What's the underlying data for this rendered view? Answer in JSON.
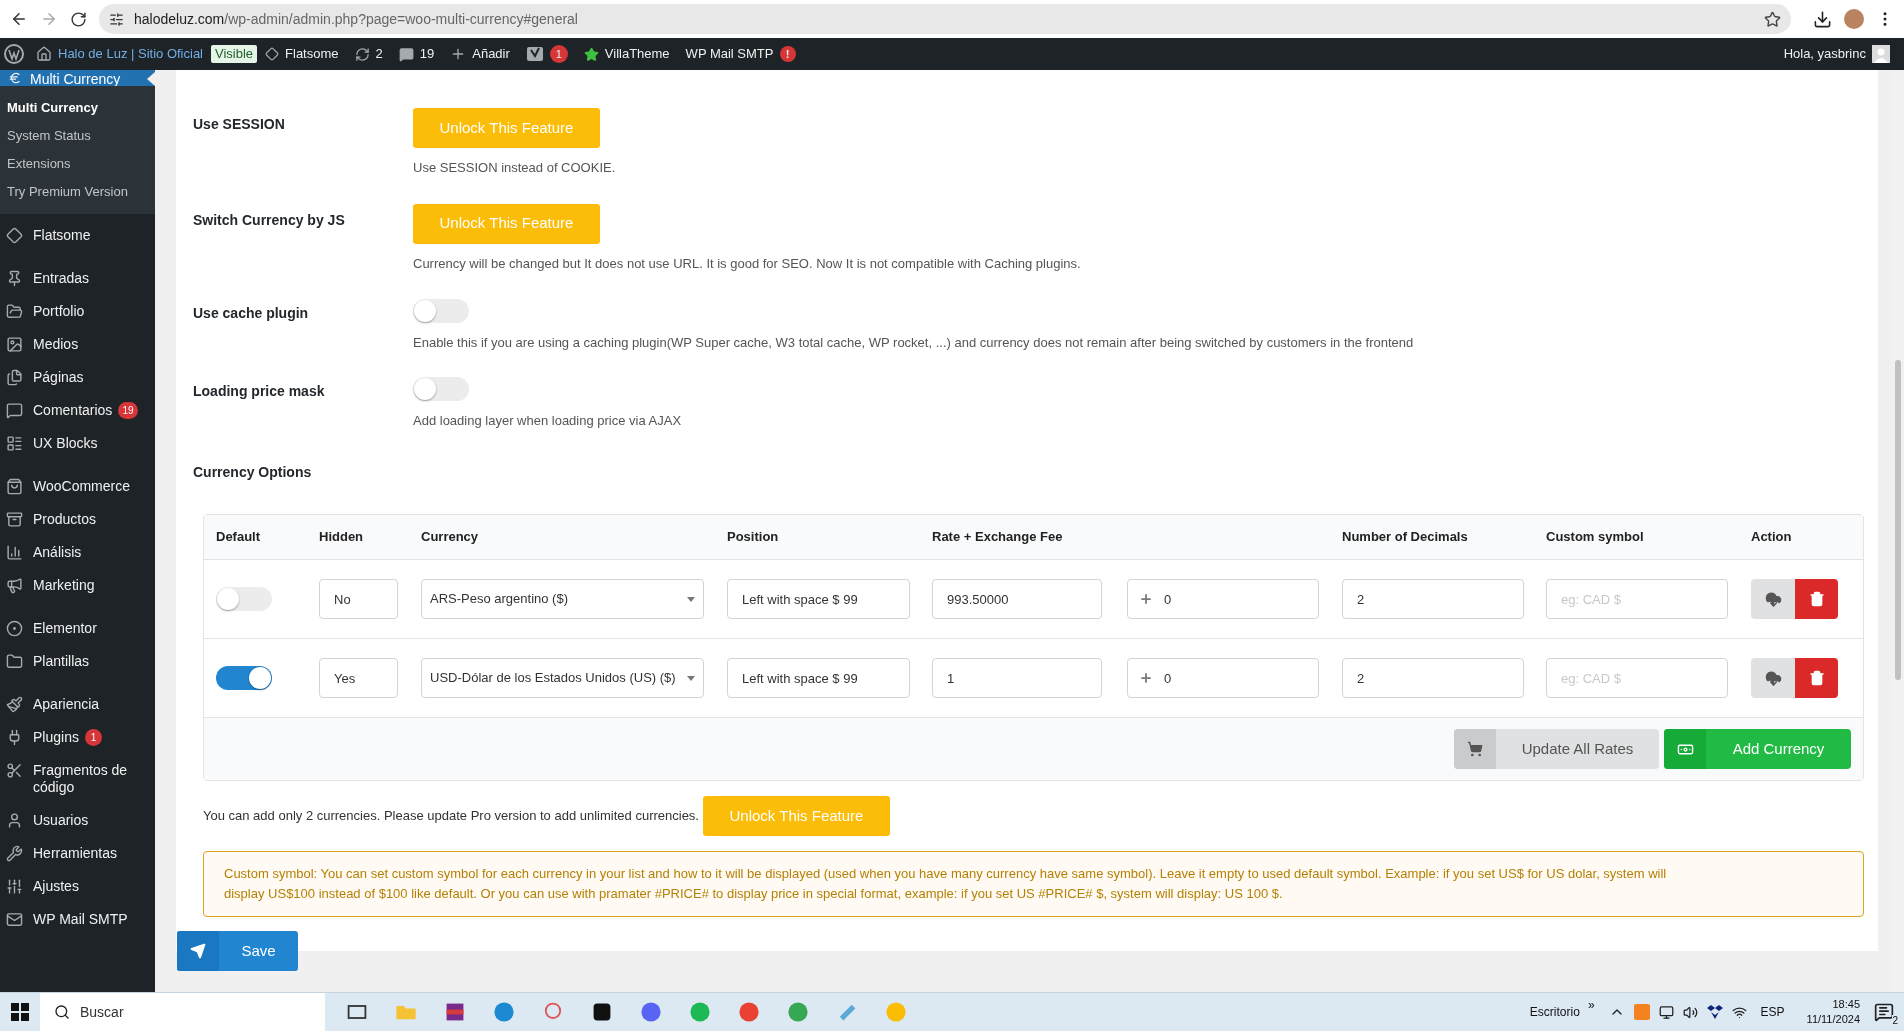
{
  "browser": {
    "url_host": "halodeluz.com",
    "url_path": "/wp-admin/admin.php?page=woo-multi-currency#general"
  },
  "admin_bar": {
    "site": "Halo de Luz | Sitio Oficial",
    "visibility": "Visible",
    "theme": "Flatsome",
    "updates": "2",
    "comments": "19",
    "new": "Añadir",
    "seo_count": "1",
    "villatheme": "VillaTheme",
    "smtp": "WP Mail SMTP",
    "smtp_alert": "!",
    "greeting": "Hola, yasbrinc"
  },
  "sidebar": {
    "current": "Multi Currency",
    "submenu": [
      {
        "label": "Multi Currency",
        "selected": true
      },
      {
        "label": "System Status",
        "selected": false
      },
      {
        "label": "Extensions",
        "selected": false
      },
      {
        "label": "Try Premium Version",
        "selected": false
      }
    ],
    "groups": [
      [
        {
          "label": "Flatsome"
        }
      ],
      [
        {
          "label": "Entradas"
        },
        {
          "label": "Portfolio"
        },
        {
          "label": "Medios"
        },
        {
          "label": "Páginas"
        },
        {
          "label": "Comentarios",
          "badge": "19"
        },
        {
          "label": "UX Blocks"
        }
      ],
      [
        {
          "label": "WooCommerce"
        },
        {
          "label": "Productos"
        },
        {
          "label": "Análisis"
        },
        {
          "label": "Marketing"
        }
      ],
      [
        {
          "label": "Elementor"
        },
        {
          "label": "Plantillas"
        }
      ],
      [
        {
          "label": "Apariencia"
        },
        {
          "label": "Plugins",
          "badge": "1"
        },
        {
          "label": "Fragmentos de código"
        },
        {
          "label": "Usuarios"
        },
        {
          "label": "Herramientas"
        },
        {
          "label": "Ajustes"
        },
        {
          "label": "WP Mail SMTP"
        }
      ]
    ]
  },
  "settings": [
    {
      "kind": "locked",
      "label": "Use SESSION",
      "button": "Unlock This Feature",
      "description": "Use SESSION instead of COOKIE."
    },
    {
      "kind": "locked",
      "label": "Switch Currency by JS",
      "button": "Unlock This Feature",
      "description": "Currency will be changed but It does not use URL. It is good for SEO. Now It is not compatible with Caching plugins."
    },
    {
      "kind": "toggle",
      "label": "Use cache plugin",
      "on": false,
      "description": "Enable this if you are using a caching plugin(WP Super cache, W3 total cache, WP rocket, ...) and currency does not remain after being switched by customers in the frontend"
    },
    {
      "kind": "toggle",
      "label": "Loading price mask",
      "on": false,
      "description": "Add loading layer when loading price via AJAX"
    }
  ],
  "currency_options": {
    "title": "Currency Options",
    "columns": [
      "Default",
      "Hidden",
      "Currency",
      "Position",
      "Rate + Exchange Fee",
      "Number of Decimals",
      "Custom symbol",
      "Action"
    ],
    "rows": [
      {
        "default": false,
        "hidden": "No",
        "currency": "ARS-Peso argentino ($)",
        "position": "Left with space $ 99",
        "rate": "993.50000",
        "fee": "0",
        "decimals": "2",
        "custom_symbol_placeholder": "eg: CAD $"
      },
      {
        "default": true,
        "hidden": "Yes",
        "currency": "USD-Dólar de los Estados Unidos (US) ($)",
        "position": "Left with space $ 99",
        "rate": "1",
        "fee": "0",
        "decimals": "2",
        "custom_symbol_placeholder": "eg: CAD $"
      }
    ],
    "update_button": "Update All Rates",
    "add_button": "Add Currency"
  },
  "limit_notice": "You can add only 2 currencies. Please update Pro version to add unlimited currencies.",
  "limit_button": "Unlock This Feature",
  "help_notice": "Custom symbol: You can set custom symbol for each currency in your list and how to it will be displayed (used when you have many currency have same symbol). Leave it empty to used default symbol. Example: if you set US$ for US dolar, system will display US$100 instead of $100 like default. Or you can use with pramater #PRICE# to display price in special format, example: if you set US #PRICE# $, system will display: US 100 $.",
  "save_button": "Save",
  "taskbar": {
    "search_placeholder": "Buscar",
    "desktop": "Escritorio",
    "more": "»",
    "language": "ESP",
    "time": "18:45",
    "date": "11/11/2024",
    "notifications": "2"
  }
}
